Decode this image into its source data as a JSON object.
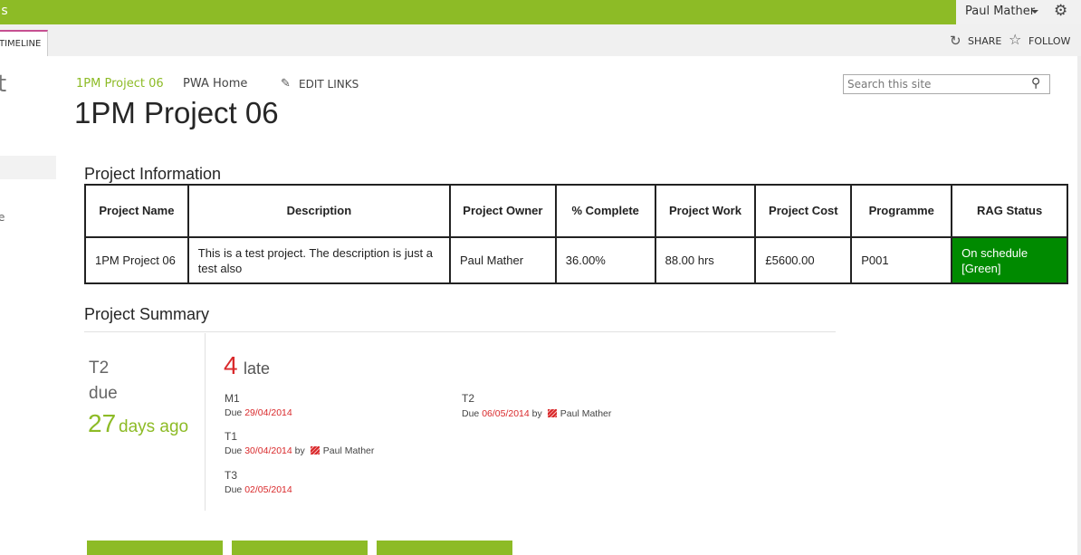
{
  "suite_bar": {
    "brand_fragment": "ıs",
    "user_name": "Paul Mather",
    "settings_icon": "gear-icon"
  },
  "ribbon": {
    "tab_label": "TIMELINE",
    "share_label": "SHARE",
    "follow_label": "FOLLOW"
  },
  "left_nav": {
    "title_fragment": "t",
    "item_fragment": "e"
  },
  "breadcrumb": {
    "current": "1PM Project 06",
    "home": "PWA Home",
    "edit_links": "EDIT LINKS"
  },
  "search": {
    "placeholder": "Search this site"
  },
  "page_title": "1PM Project 06",
  "project_information": {
    "heading": "Project Information",
    "columns": [
      "Project Name",
      "Description",
      "Project Owner",
      "% Complete",
      "Project Work",
      "Project Cost",
      "Programme",
      "RAG Status"
    ],
    "row": {
      "name": "1PM Project 06",
      "description": "This is a test project. The description is just a test also",
      "owner": "Paul Mather",
      "complete": "36.00%",
      "work": "88.00 hrs",
      "cost": "£5600.00",
      "programme": "P001",
      "rag_status": "On schedule [Green]"
    },
    "rag_color": "#008a00"
  },
  "project_summary": {
    "heading": "Project Summary",
    "next_due": {
      "task": "T2",
      "label": "due",
      "days": "27",
      "unit": "days ago"
    },
    "late": {
      "count": "4",
      "label": "late"
    },
    "tasks": [
      {
        "name": "M1",
        "due_prefix": "Due",
        "date": "29/04/2014",
        "by": "",
        "assignee": ""
      },
      {
        "name": "T1",
        "due_prefix": "Due",
        "date": "30/04/2014",
        "by": "by",
        "assignee": "Paul Mather"
      },
      {
        "name": "T3",
        "due_prefix": "Due",
        "date": "02/05/2014",
        "by": "",
        "assignee": ""
      },
      {
        "name": "T2",
        "due_prefix": "Due",
        "date": "06/05/2014",
        "by": "by",
        "assignee": "Paul Mather"
      }
    ]
  },
  "colors": {
    "accent": "#8dbb26",
    "late_red": "#d9292b"
  }
}
